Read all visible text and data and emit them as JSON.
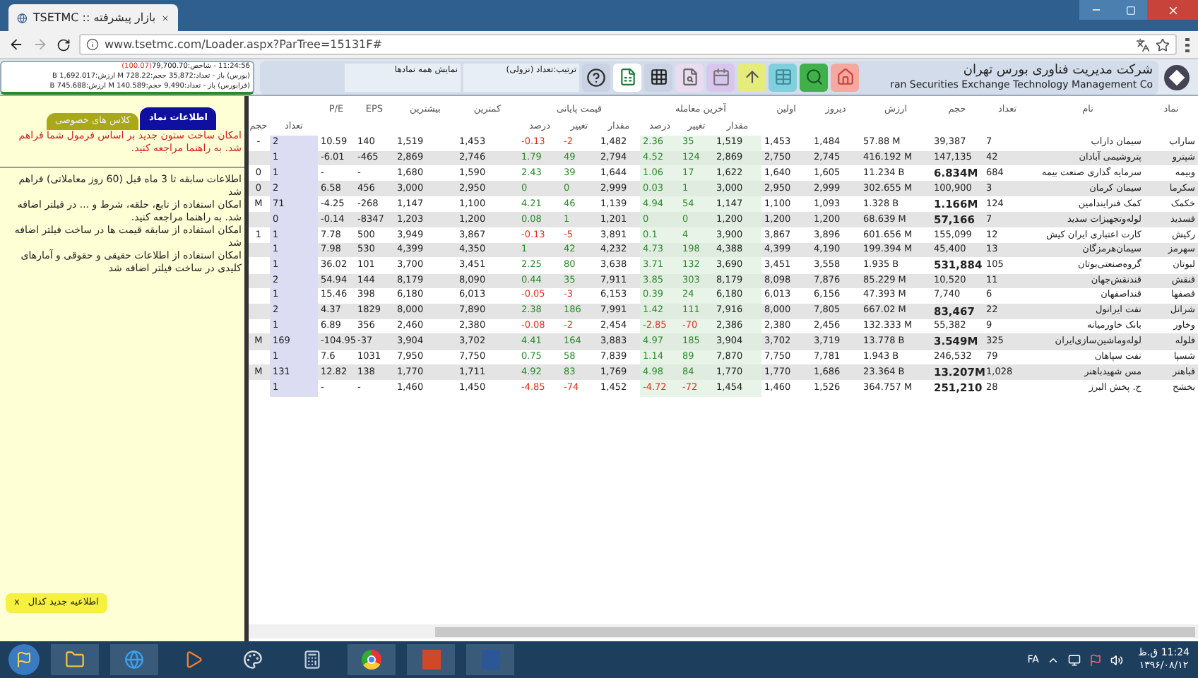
{
  "browser": {
    "tab_title": "بازار پیشرفته :: TSETMC",
    "url": "www.tsetmc.com/Loader.aspx?ParTree=15131F#"
  },
  "market_info": {
    "time": "11:24:56 - شاخص:79,700.70",
    "index_change": "(100.07)",
    "bourse": "(بورس) باز - تعداد:35,872 حجم:728.22 M ارزش:1,692.017 B",
    "farabourse": "(فرابورس) باز - تعداد:9,490 حجم:140.589 M ارزش:745.688 B"
  },
  "toolbar": {
    "sort": "ترتیب:تعداد (نزولی)",
    "filter": "نمایش همه نمادها"
  },
  "company": {
    "name_fa": "شرکت مدیریت فناوری بورس تهران",
    "name_en": "ran Securities Exchange Technology Management Co"
  },
  "side_tabs": [
    {
      "label": "اطلاعات نماد",
      "selected": true
    },
    {
      "label": "کلاس های خصوصی",
      "selected": false
    }
  ],
  "notice_highlight": "امکان ساخت ستون جدید بر اساس فرمول شما فراهم شد. به راهنما مراجعه کنید.",
  "notices": [
    "اطلاعات سابقه تا 3 ماه قبل (60 روز معاملاتی) فراهم شد",
    "امکان استفاده از تابع، حلقه، شرط و ... در فیلتر اضافه شد. به راهنما مراجعه کنید.",
    "امکان استفاده از سابقه قیمت ها در ساخت فیلتر اضافه شد",
    "امکان استفاده از اطلاعات حقیقی و حقوقی و آمارهای کلیدی در ساخت فیلتر اضافه شد"
  ],
  "codal_button": {
    "close": "x",
    "label": "اطلاعیه جدید کدال"
  },
  "headers": [
    {
      "kind": "high",
      "label": "نماد"
    },
    {
      "kind": "high",
      "label": "نام"
    },
    {
      "kind": "high",
      "label": "تعداد"
    },
    {
      "kind": "high",
      "label": "حجم"
    },
    {
      "kind": "high",
      "label": "ارزش"
    },
    {
      "kind": "high",
      "label": "دیروز"
    },
    {
      "kind": "high",
      "label": "اولین"
    },
    {
      "kind": "group",
      "label": "آخرین معامله",
      "subs": [
        "مقدار",
        "تغییر",
        "درصد"
      ]
    },
    {
      "kind": "group",
      "label": "قیمت پایانی",
      "subs": [
        "مقدار",
        "تغییر",
        "درصد"
      ]
    },
    {
      "kind": "high",
      "label": "کمترین"
    },
    {
      "kind": "high",
      "label": "بیشترین"
    },
    {
      "kind": "high",
      "label": "EPS"
    },
    {
      "kind": "high",
      "label": "P/E"
    },
    {
      "kind": "low",
      "label": "تعداد"
    },
    {
      "kind": "low",
      "label": "حجم"
    }
  ],
  "rows": [
    {
      "flag": "-",
      "cells": [
        "2",
        "10.59",
        "140",
        "1,519",
        "1,453",
        "-0.13",
        "-2",
        "1,482",
        "2.36",
        "35",
        "1,519",
        "1,453",
        "1,484",
        "57.88 M",
        "39,387",
        "7"
      ],
      "name": "سیمان داراب",
      "symbol": "ساراب",
      "last_falling": false,
      "close_falling": true,
      "vol_bold": false
    },
    {
      "cells": [
        "1",
        "-6.01",
        "-465",
        "2,869",
        "2,746",
        "1.79",
        "49",
        "2,794",
        "4.52",
        "124",
        "2,869",
        "2,750",
        "2,745",
        "416.192 M",
        "147,135",
        "42"
      ],
      "name": "پتروشیمی آبادان",
      "symbol": "شپترو",
      "last_falling": false,
      "close_falling": false,
      "vol_bold": false
    },
    {
      "flag": "0",
      "cells": [
        "1",
        "-",
        "-",
        "1,680",
        "1,590",
        "2.43",
        "39",
        "1,644",
        "1.06",
        "17",
        "1,622",
        "1,640",
        "1,605",
        "11.234 B",
        "6.834M",
        "684"
      ],
      "name": "سرمایه گذاری صنعت بیمه",
      "symbol": "وبیمه",
      "last_falling": false,
      "close_falling": false,
      "vol_bold": true
    },
    {
      "flag": "0",
      "cells": [
        "2",
        "6.58",
        "456",
        "3,000",
        "2,950",
        "0",
        "0",
        "2,999",
        "0.03",
        "1",
        "3,000",
        "2,950",
        "2,999",
        "302.655 M",
        "100,900",
        "3"
      ],
      "name": "سیمان کرمان",
      "symbol": "سکرما",
      "last_falling": false,
      "close_falling": false,
      "vol_bold": false
    },
    {
      "flag": "M",
      "cells": [
        "71",
        "-4.25",
        "-268",
        "1,147",
        "1,100",
        "4.21",
        "46",
        "1,139",
        "4.94",
        "54",
        "1,147",
        "1,100",
        "1,093",
        "1.328 B",
        "1.166M",
        "124"
      ],
      "name": "کمک فنرایندامین",
      "symbol": "خکمک",
      "last_falling": false,
      "close_falling": false,
      "vol_bold": true
    },
    {
      "cells": [
        "0",
        "-0.14",
        "-8347",
        "1,203",
        "1,200",
        "0.08",
        "1",
        "1,201",
        "0",
        "0",
        "1,200",
        "1,200",
        "1,200",
        "68.639 M",
        "57,166",
        "7"
      ],
      "name": "لوله‌وتجهیزات سدید",
      "symbol": "فسدید",
      "last_falling": false,
      "close_falling": false,
      "vol_bold": true
    },
    {
      "flag": "1",
      "cells": [
        "1",
        "7.78",
        "500",
        "3,949",
        "3,867",
        "-0.13",
        "-5",
        "3,891",
        "0.1",
        "4",
        "3,900",
        "3,867",
        "3,896",
        "601.656 M",
        "155,099",
        "12"
      ],
      "name": "کارت اعتباری ایران کیش",
      "symbol": "رکیش",
      "last_falling": false,
      "close_falling": true,
      "vol_bold": false
    },
    {
      "cells": [
        "1",
        "7.98",
        "530",
        "4,399",
        "4,350",
        "1",
        "42",
        "4,232",
        "4.73",
        "198",
        "4,388",
        "4,399",
        "4,190",
        "199.394 M",
        "45,400",
        "13"
      ],
      "name": "سیمان‌هرمزگان",
      "symbol": "سهرمز",
      "last_falling": false,
      "close_falling": false,
      "vol_bold": false
    },
    {
      "cells": [
        "1",
        "36.02",
        "101",
        "3,700",
        "3,451",
        "2.25",
        "80",
        "3,638",
        "3.71",
        "132",
        "3,690",
        "3,451",
        "3,558",
        "1.935 B",
        "531,884",
        "105"
      ],
      "name": "گروه‌صنعتی‌بوتان",
      "symbol": "لبوتان",
      "last_falling": false,
      "close_falling": false,
      "vol_bold": true
    },
    {
      "cells": [
        "2",
        "54.94",
        "144",
        "8,179",
        "8,090",
        "0.44",
        "35",
        "7,911",
        "3.85",
        "303",
        "8,179",
        "8,098",
        "7,876",
        "85.229 M",
        "10,520",
        "11"
      ],
      "name": "قندنقش‌جهان",
      "symbol": "قنقش",
      "last_falling": false,
      "close_falling": false,
      "vol_bold": false
    },
    {
      "cells": [
        "1",
        "15.46",
        "398",
        "6,180",
        "6,013",
        "-0.05",
        "-3",
        "6,153",
        "0.39",
        "24",
        "6,180",
        "6,013",
        "6,156",
        "47.393 M",
        "7,740",
        "6"
      ],
      "name": "قنداصفهان",
      "symbol": "قصفها",
      "last_falling": false,
      "close_falling": true,
      "vol_bold": false
    },
    {
      "cells": [
        "2",
        "4.37",
        "1829",
        "8,000",
        "7,890",
        "2.38",
        "186",
        "7,991",
        "1.42",
        "111",
        "7,916",
        "8,000",
        "7,805",
        "667.02 M",
        "83,467",
        "22"
      ],
      "name": "نفت ایرانول",
      "symbol": "شرانل",
      "last_falling": false,
      "close_falling": false,
      "vol_bold": true
    },
    {
      "cells": [
        "1",
        "6.89",
        "356",
        "2,460",
        "2,380",
        "-0.08",
        "-2",
        "2,454",
        "-2.85",
        "-70",
        "2,386",
        "2,380",
        "2,456",
        "132.333 M",
        "55,382",
        "9"
      ],
      "name": "بانک خاورمیانه",
      "symbol": "وخاور",
      "last_falling": true,
      "close_falling": true,
      "vol_bold": false
    },
    {
      "flag": "M",
      "cells": [
        "169",
        "-104.95",
        "-37",
        "3,904",
        "3,702",
        "4.41",
        "164",
        "3,883",
        "4.97",
        "185",
        "3,904",
        "3,702",
        "3,719",
        "13.778 B",
        "3.549M",
        "325"
      ],
      "name": "لوله‌وماشین‌سازی‌ایران",
      "symbol": "فلوله",
      "last_falling": false,
      "close_falling": false,
      "vol_bold": true
    },
    {
      "cells": [
        "1",
        "7.6",
        "1031",
        "7,950",
        "7,750",
        "0.75",
        "58",
        "7,839",
        "1.14",
        "89",
        "7,870",
        "7,750",
        "7,781",
        "1.943 B",
        "246,532",
        "79"
      ],
      "name": "نفت سپاهان",
      "symbol": "شسپا",
      "last_falling": false,
      "close_falling": false,
      "vol_bold": false
    },
    {
      "flag": "M",
      "cells": [
        "131",
        "12.82",
        "138",
        "1,770",
        "1,711",
        "4.92",
        "83",
        "1,769",
        "4.98",
        "84",
        "1,770",
        "1,770",
        "1,686",
        "23.364 B",
        "13.207M",
        "1,028"
      ],
      "name": "مس شهیدباهنر",
      "symbol": "فباهنر",
      "last_falling": false,
      "close_falling": false,
      "vol_bold": true
    },
    {
      "cells": [
        "1",
        "-",
        "-",
        "1,460",
        "1,450",
        "-4.85",
        "-74",
        "1,452",
        "-4.72",
        "-72",
        "1,454",
        "1,460",
        "1,526",
        "364.757 M",
        "251,210",
        "28"
      ],
      "name": "ح. پخش البرز",
      "symbol": "بخشح",
      "last_falling": true,
      "close_falling": true,
      "vol_bold": true
    }
  ],
  "taskbar": {
    "language": "FA",
    "time": "11:24 ق.ظ",
    "date": "۱۳۹۶/۰۸/۱۲"
  }
}
